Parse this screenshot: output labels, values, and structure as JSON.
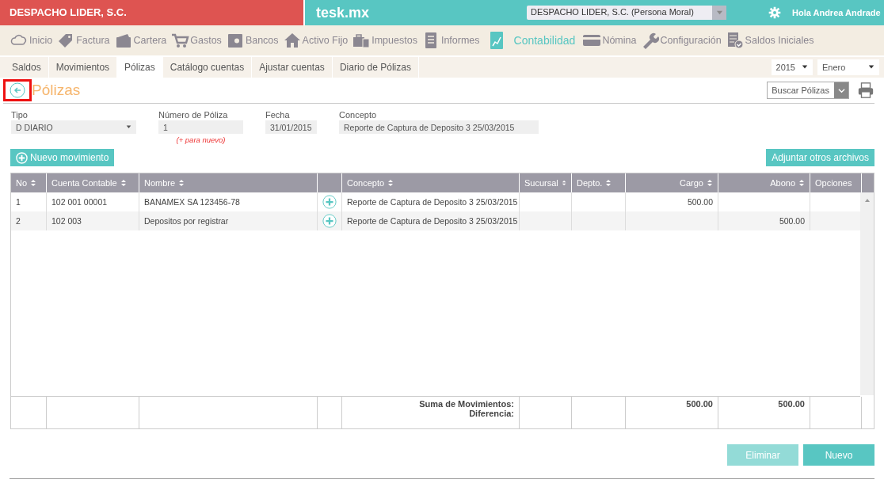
{
  "header": {
    "company": "DESPACHO LIDER, S.C.",
    "brand": "tesk.mx",
    "company_select": "DESPACHO LIDER, S.C. (Persona Moral)",
    "greeting": "Hola Andrea Andrade"
  },
  "nav": [
    {
      "label": "Inicio",
      "selected": false
    },
    {
      "label": "Factura",
      "selected": false
    },
    {
      "label": "Cartera",
      "selected": false
    },
    {
      "label": "Gastos",
      "selected": false
    },
    {
      "label": "Bancos",
      "selected": false
    },
    {
      "label": "Activo Fijo",
      "selected": false
    },
    {
      "label": "Impuestos",
      "selected": false
    },
    {
      "label": "Informes",
      "selected": false
    },
    {
      "label": "Contabilidad",
      "selected": true
    },
    {
      "label": "Nómina",
      "selected": false
    },
    {
      "label": "Configuración",
      "selected": false
    },
    {
      "label": "Saldos Iniciales",
      "selected": false
    }
  ],
  "tabs": [
    {
      "label": "Saldos",
      "selected": false
    },
    {
      "label": "Movimientos",
      "selected": false
    },
    {
      "label": "Pólizas",
      "selected": true
    },
    {
      "label": "Catálogo cuentas",
      "selected": false
    },
    {
      "label": "Ajustar cuentas",
      "selected": false
    },
    {
      "label": "Diario de Pólizas",
      "selected": false
    }
  ],
  "period": {
    "year": "2015",
    "month": "Enero"
  },
  "page": {
    "title": "Pólizas",
    "back_highlighted": true,
    "search": "Buscar Pólizas"
  },
  "form": {
    "tipo_label": "Tipo",
    "tipo": "D DIARIO",
    "numero_label": "Número de Póliza",
    "numero": "1",
    "numero_hint": "(+ para nuevo)",
    "fecha_label": "Fecha",
    "fecha": "31/01/2015",
    "concepto_label": "Concepto",
    "concepto": "Reporte de Captura de Deposito 3 25/03/2015"
  },
  "actions": {
    "new_movement": "Nuevo movimiento",
    "attach": "Adjuntar otros archivos"
  },
  "table": {
    "columns": [
      {
        "label": "No",
        "sortable": true
      },
      {
        "label": "Cuenta Contable",
        "sortable": true
      },
      {
        "label": "Nombre",
        "sortable": true
      },
      {
        "label": "Concepto",
        "sortable": true
      },
      {
        "label": "Sucursal",
        "sortable": true
      },
      {
        "label": "Depto.",
        "sortable": true
      },
      {
        "label": "Cargo",
        "sortable": true
      },
      {
        "label": "Abono",
        "sortable": true
      },
      {
        "label": "Opciones"
      }
    ],
    "rows": [
      {
        "no": "1",
        "cuenta": "102 001 00001",
        "nombre": "BANAMEX SA 123456-78",
        "concepto": "Reporte de Captura de Deposito 3 25/03/2015",
        "cargo": "500.00"
      },
      {
        "no": "2",
        "cuenta": "102 003",
        "nombre": "Depositos por registrar",
        "concepto": "Reporte de Captura de Deposito 3 25/03/2015",
        "abono": "500.00"
      }
    ],
    "totals": {
      "sum_label": "Suma de Movimientos:",
      "diff_label": "Diferencia:",
      "cargo": "500.00",
      "abono": "500.00"
    }
  },
  "buttons": [
    {
      "label": "Eliminar",
      "disabled": true
    },
    {
      "label": "Nuevo",
      "disabled": false
    }
  ]
}
